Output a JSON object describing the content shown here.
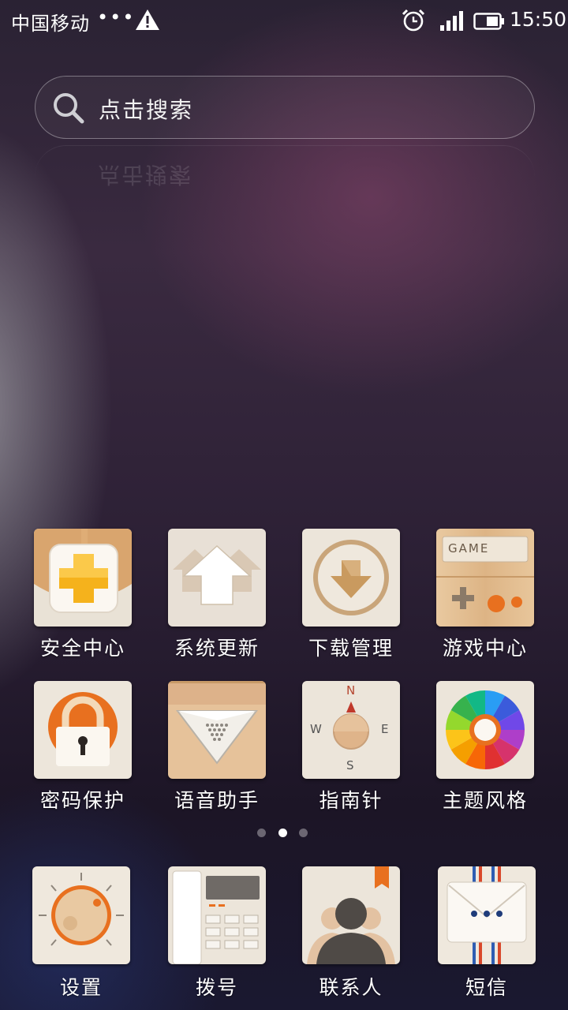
{
  "status_bar": {
    "carrier": "中国移动",
    "dots": "•••",
    "time": "15:50",
    "icons": [
      "warning-icon",
      "alarm-icon",
      "signal-icon",
      "battery-icon"
    ]
  },
  "search": {
    "placeholder": "点击搜索"
  },
  "apps": [
    {
      "label": "安全中心",
      "icon": "security-plus-icon"
    },
    {
      "label": "系统更新",
      "icon": "update-arrow-icon"
    },
    {
      "label": "下载管理",
      "icon": "download-icon"
    },
    {
      "label": "游戏中心",
      "icon": "game-icon",
      "badge_text": "GAME"
    },
    {
      "label": "密码保护",
      "icon": "padlock-icon"
    },
    {
      "label": "语音助手",
      "icon": "voice-speaker-icon"
    },
    {
      "label": "指南针",
      "icon": "compass-icon",
      "directions": [
        "N",
        "W",
        "E",
        "S"
      ]
    },
    {
      "label": "主题风格",
      "icon": "color-wheel-icon"
    }
  ],
  "page_indicator": {
    "count": 3,
    "active": 1
  },
  "dock": [
    {
      "label": "设置",
      "icon": "settings-dial-icon"
    },
    {
      "label": "拨号",
      "icon": "phone-icon"
    },
    {
      "label": "联系人",
      "icon": "contacts-icon"
    },
    {
      "label": "短信",
      "icon": "envelope-icon"
    }
  ],
  "colors": {
    "accent_orange": "#e8701f",
    "wood": "#e8c49a",
    "tile_cream": "#efe8dc"
  }
}
